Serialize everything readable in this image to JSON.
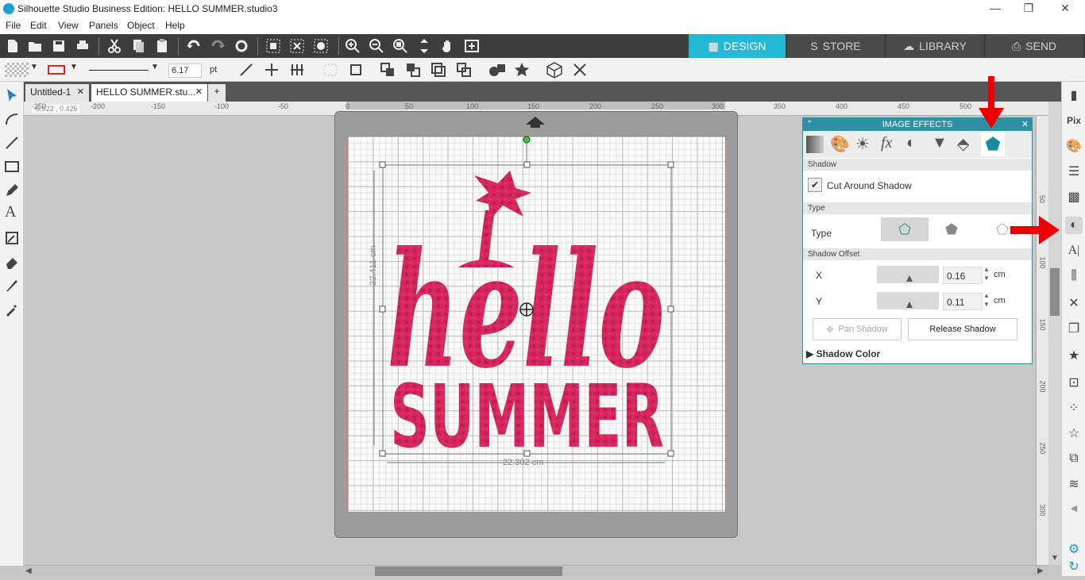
{
  "window": {
    "title": "Silhouette Studio Business Edition: HELLO SUMMER.studio3",
    "minimize": "—",
    "restore": "❐",
    "close": "✕"
  },
  "menu": [
    "File",
    "Edit",
    "View",
    "Panels",
    "Object",
    "Help"
  ],
  "modes": [
    {
      "label": "DESIGN",
      "active": true
    },
    {
      "label": "STORE",
      "active": false
    },
    {
      "label": "LIBRARY",
      "active": false
    },
    {
      "label": "SEND",
      "active": false
    }
  ],
  "toolbar2": {
    "line_width_value": "6.17",
    "line_width_unit": "pt"
  },
  "tabs": [
    {
      "label": "Untitled-1",
      "close": "✕"
    },
    {
      "label": "HELLO SUMMER.stu...",
      "close": "✕"
    }
  ],
  "add_tab": "+",
  "coords": "-8.922 , 0.425",
  "ruler_top_labels": [
    "-250",
    "-200",
    "-150",
    "-100",
    "-50",
    "0",
    "50",
    "100",
    "150",
    "200",
    "250",
    "300",
    "350",
    "400",
    "450",
    "500"
  ],
  "ruler_right_labels": [
    "50",
    "100",
    "150",
    "200",
    "250",
    "300"
  ],
  "design": {
    "height_label": "22.411 cm",
    "width_label": "22.302 cm",
    "text_top": "hello",
    "text_bottom": "SUMMER",
    "fill_color": "#d8275f"
  },
  "effects_panel": {
    "title": "IMAGE EFFECTS",
    "section_shadow": "Shadow",
    "cut_around_label": "Cut Around Shadow",
    "cut_around_checked": true,
    "section_type": "Type",
    "type_label": "Type",
    "section_offset": "Shadow Offset",
    "x_label": "X",
    "x_value": "0.16",
    "x_unit": "cm",
    "y_label": "Y",
    "y_value": "0.11",
    "y_unit": "cm",
    "pan_shadow": "Pan Shadow",
    "release_shadow": "Release Shadow",
    "shadow_color": "Shadow Color"
  },
  "colors": {
    "accent": "#24b8d7",
    "panel_header": "#2f8fa3",
    "arrow": "#e00000"
  }
}
